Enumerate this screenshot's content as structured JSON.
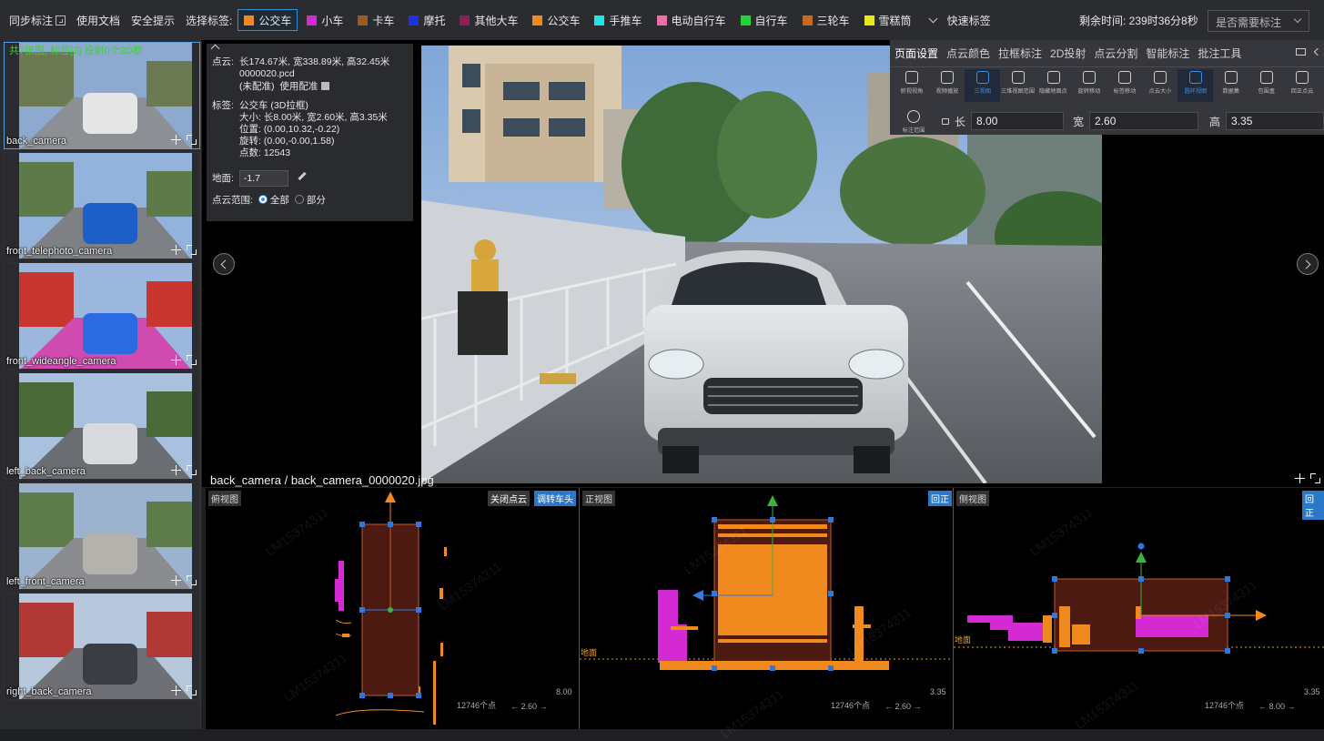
{
  "topbar": {
    "sync_label": "同步标注",
    "docs_label": "使用文档",
    "safety_label": "安全提示",
    "select_tag_label": "选择标签:",
    "tags": [
      {
        "label": "公交车",
        "color": "#f08a1e",
        "active": true
      },
      {
        "label": "小车",
        "color": "#d629d6"
      },
      {
        "label": "卡车",
        "color": "#9b5a1e"
      },
      {
        "label": "摩托",
        "color": "#1f2ee8"
      },
      {
        "label": "其他大车",
        "color": "#8e1e5a"
      },
      {
        "label": "公交车",
        "color": "#f08a1e"
      },
      {
        "label": "手推车",
        "color": "#22e4e8"
      },
      {
        "label": "电动自行车",
        "color": "#f06ea8"
      },
      {
        "label": "自行车",
        "color": "#22d43a"
      },
      {
        "label": "三轮车",
        "color": "#c86a1e"
      },
      {
        "label": "雪糕筒",
        "color": "#e8e81e"
      }
    ],
    "quick_tag_label": "快速标签",
    "timer_label": "剩余时间: 239时36分8秒",
    "need_label_select": "是否需要标注"
  },
  "cameras": {
    "summary": "共7张图, 标签[2] 投射0个2D框",
    "items": [
      {
        "name": "back_camera",
        "selected": true
      },
      {
        "name": "front_telephoto_camera"
      },
      {
        "name": "front_wideangle_camera"
      },
      {
        "name": "left_back_camera"
      },
      {
        "name": "left_front_camera"
      },
      {
        "name": "right_back_camera"
      }
    ]
  },
  "info": {
    "cloud_key": "点云:",
    "cloud_dims": "长174.67米, 宽338.89米, 高32.45米",
    "cloud_file": "0000020.pcd",
    "unpaired": "(未配准)",
    "use_pair": "使用配准",
    "label_key": "标签:",
    "label_value": "公交车 (3D拉框)",
    "size": "大小: 长8.00米, 宽2.60米, 高3.35米",
    "position": "位置: (0.00,10.32,-0.22)",
    "rotation": "旋转: (0.00,-0.00,1.58)",
    "points": "点数: 12543",
    "ground_key": "地面:",
    "ground_value": "-1.7",
    "range_key": "点云范围:",
    "range_all": "全部",
    "range_part": "部分"
  },
  "viewer": {
    "caption": "back_camera / back_camera_0000020.jpg"
  },
  "settings": {
    "tabs": [
      "页面设置",
      "点云颜色",
      "拉框标注",
      "2D投射",
      "点云分割",
      "智能标注",
      "批注工具"
    ],
    "active_tab": 0,
    "tools": [
      {
        "label": "俯视视角"
      },
      {
        "label": "视频播放"
      },
      {
        "label": "三视图",
        "on": true
      },
      {
        "label": "三维视图范围"
      },
      {
        "label": "隐藏地面点"
      },
      {
        "label": "旋转移动"
      },
      {
        "label": "标签移动"
      },
      {
        "label": "点云大小"
      },
      {
        "label": "圆环视图",
        "on": true
      },
      {
        "label": "数据集"
      },
      {
        "label": "包围盒"
      },
      {
        "label": "回正点云"
      }
    ],
    "range_tool_label": "标注范围",
    "length_label": "长",
    "length_value": "8.00",
    "width_label": "宽",
    "width_value": "2.60",
    "height_label": "高",
    "height_value": "3.35"
  },
  "views": {
    "top": {
      "title": "俯视图",
      "btn1": "关闭点云",
      "btn2": "调转车头",
      "points": "12746个点",
      "w": "2.60",
      "h": "8.00"
    },
    "front": {
      "title": "正视图",
      "btn": "回正",
      "ground": "地面",
      "points": "12746个点",
      "w": "2.60",
      "h": "3.35"
    },
    "side": {
      "title": "侧视图",
      "btn": "回正",
      "ground": "地面",
      "points": "12746个点",
      "w": "8.00",
      "h": "3.35"
    }
  },
  "watermark": "LM15374311"
}
